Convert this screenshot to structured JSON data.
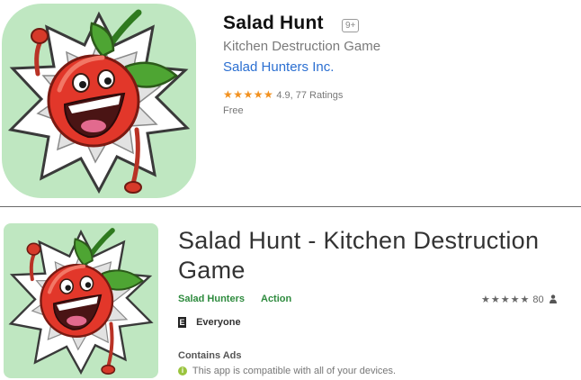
{
  "ios_listing": {
    "title": "Salad Hunt",
    "age_rating": "9+",
    "subtitle": "Kitchen Destruction Game",
    "developer": "Salad Hunters Inc.",
    "stars": "★★★★★",
    "rating_value": 4.9,
    "rating_text": "4.9, 77 Ratings",
    "price": "Free",
    "colors": {
      "developer": "#2b6fd1",
      "stars": "#f2911f"
    }
  },
  "google_play_listing": {
    "title": "Salad Hunt - Kitchen Destruction Game",
    "developer": "Salad Hunters",
    "genre": "Action",
    "stars": "★★★★★",
    "rating_count": "80",
    "content_rating_icon": "E",
    "content_rating": "Everyone",
    "ads_label": "Contains Ads",
    "compatibility": "This app is compatible with all of your devices.",
    "info_icon": "i",
    "colors": {
      "developer": "#2e8b3e",
      "genre": "#2e8b3e",
      "info": "#9ac43e"
    }
  },
  "icons": {
    "app_icon": "radish-character-icon",
    "person": "person-icon",
    "esrb": "esrb-everyone-icon",
    "info": "info-icon"
  }
}
